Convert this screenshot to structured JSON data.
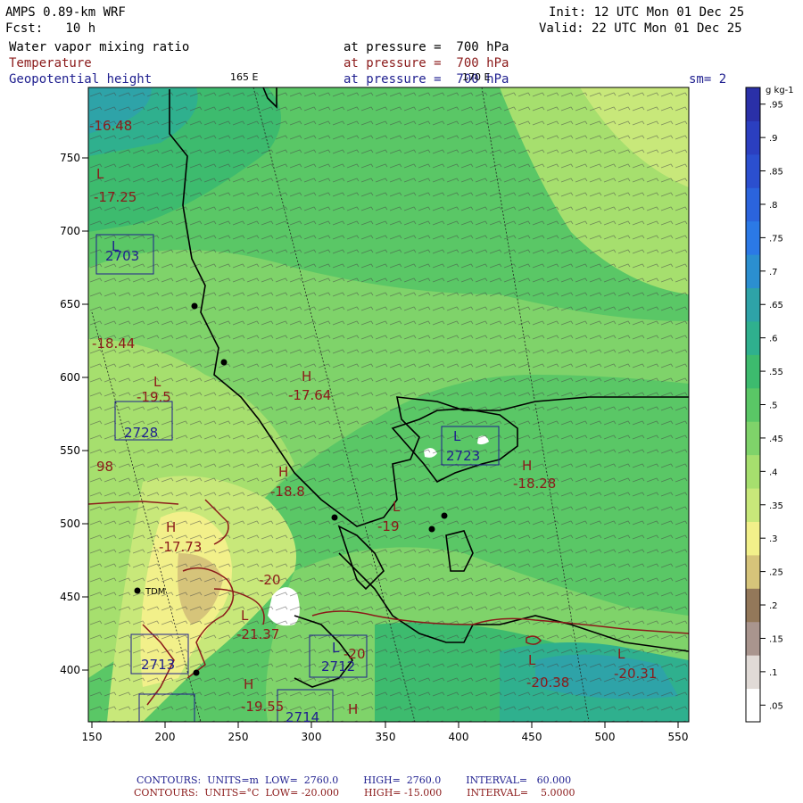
{
  "header": {
    "model": "AMPS 0.89-km WRF",
    "init": "Init: 12 UTC Mon 01 Dec 25",
    "fcst": "Fcst:   10 h",
    "valid": "Valid: 22 UTC Mon 01 Dec 25",
    "field1": "Water vapor mixing ratio",
    "field1_level": "at pressure =  700 hPa",
    "field2": "Temperature",
    "field2_level": "at pressure =  700 hPa",
    "field3": "Geopotential height",
    "field3_level": "at pressure =  700 hPa",
    "smoothing": "sm= 2",
    "lon_label_1": "165 E",
    "lon_label_2": "170 E"
  },
  "axes": {
    "x_ticks": [
      "150",
      "200",
      "250",
      "300",
      "350",
      "400",
      "450",
      "500",
      "550"
    ],
    "y_ticks": [
      "400",
      "450",
      "500",
      "550",
      "600",
      "650",
      "700",
      "750"
    ]
  },
  "colorbar": {
    "unit": "g kg-1",
    "labels": [
      ".05",
      ".1",
      ".15",
      ".2",
      ".25",
      ".3",
      ".35",
      ".4",
      ".45",
      ".5",
      ".55",
      ".6",
      ".65",
      ".7",
      ".75",
      ".8",
      ".85",
      ".9",
      ".95"
    ],
    "colors": [
      "#ffffff",
      "#e0dad6",
      "#a9958e",
      "#93785a",
      "#d6c47a",
      "#f2f08a",
      "#c8e87a",
      "#a6df6e",
      "#7fd36a",
      "#5ac766",
      "#3dbb6e",
      "#2fb08e",
      "#2ea3a8",
      "#2b8fd0",
      "#2b79e6",
      "#2b64dd",
      "#2b4fcf",
      "#2b3fc0",
      "#2a30a8"
    ]
  },
  "labels": {
    "temp": [
      "-16.48",
      "-17.25",
      "-18.44",
      "-19.5",
      "-17.64",
      "-18.8",
      "-18.28",
      "-19",
      "-17.73",
      "-20",
      "-21.37",
      "-20",
      "-19.55",
      "-20.38",
      "-20.31",
      "98",
      "-20"
    ],
    "height": [
      "2703",
      "2728",
      "2723",
      "2713",
      "2712",
      "2714"
    ],
    "highs": [
      "H",
      "H",
      "H",
      "H",
      "H",
      "H"
    ],
    "lows": [
      "L",
      "L",
      "L",
      "L",
      "L",
      "L",
      "L",
      "L",
      "L"
    ],
    "station": "TDM"
  },
  "footer": {
    "line1": "CONTOURS:  UNITS=m  LOW=  2760.0        HIGH=  2760.0        INTERVAL=   60.000",
    "line2": "CONTOURS:  UNITS=°C  LOW= -20.000        HIGH= -15.000        INTERVAL=    5.0000"
  }
}
